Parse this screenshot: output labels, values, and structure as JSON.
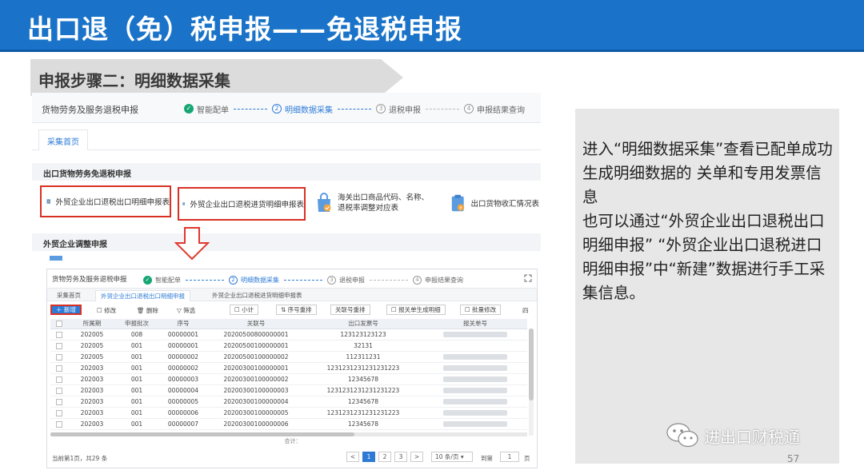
{
  "slide": {
    "title": "出口退（免）税申报——免退税申报",
    "step_banner": "申报步骤二：明细数据采集",
    "page_number": "57",
    "watermark": "进出口财税通"
  },
  "top_screen": {
    "breadcrumb_title": "货物劳务及服务退税申报",
    "steps": [
      {
        "num": "✓",
        "label": "智能配单"
      },
      {
        "num": "2",
        "label": "明细数据采集"
      },
      {
        "num": "3",
        "label": "退税申报"
      },
      {
        "num": "4",
        "label": "申报结果查询"
      }
    ],
    "home_tab": "采集首页",
    "section1": "出口货物劳务免退税申报",
    "section2": "外贸企业调整申报",
    "functions": [
      {
        "label": "外贸企业出口退税出口明细申报表"
      },
      {
        "label": "外贸企业出口退税进货明细申报表"
      },
      {
        "label": "海关出口商品代码、名称、退税率调整对应表"
      },
      {
        "label": "出口货物收汇情况表"
      }
    ]
  },
  "bottom_screen": {
    "breadcrumb_title": "货物劳务及服务退税申报",
    "steps": [
      {
        "num": "✓",
        "label": "智能配单"
      },
      {
        "num": "2",
        "label": "明细数据采集"
      },
      {
        "num": "3",
        "label": "退税申报"
      },
      {
        "num": "4",
        "label": "申报结果查询"
      }
    ],
    "tabs": [
      "采集首页",
      "外贸企业出口退税出口明细申报",
      "外贸企业出口退税进货明细申报表"
    ],
    "toolbar": {
      "new": "新增",
      "edit": "修改",
      "delete": "删除",
      "filter": "筛选",
      "subtotal": "小计",
      "renumber": "序号重排",
      "related_renumber": "关联号重排",
      "gen_form": "报关单生成明细",
      "batch_edit": "批量修改",
      "more": "四"
    },
    "columns": [
      "",
      "所属期",
      "申报批次",
      "序号",
      "关联号",
      "出口发票号",
      "报关单号"
    ],
    "rows": [
      [
        "202005",
        "008",
        "00000001",
        "20200500800000001",
        "123123123123"
      ],
      [
        "202005",
        "001",
        "00000001",
        "20200500100000001",
        "32131"
      ],
      [
        "202005",
        "001",
        "00000002",
        "20200500100000002",
        "112311231"
      ],
      [
        "202003",
        "001",
        "00000002",
        "20200300100000001",
        "1231231231231231223"
      ],
      [
        "202003",
        "001",
        "00000003",
        "20200300100000002",
        "12345678"
      ],
      [
        "202003",
        "001",
        "00000004",
        "20200300100000003",
        "1231231231231231223"
      ],
      [
        "202003",
        "001",
        "00000005",
        "20200300100000004",
        "12345678"
      ],
      [
        "202003",
        "001",
        "00000006",
        "20200300100000005",
        "1231231231231231223"
      ],
      [
        "202003",
        "001",
        "00000007",
        "20200300100000006",
        "12345678"
      ]
    ],
    "total_label": "合计：",
    "pager": {
      "info": "当前第1页，共29 条",
      "prev": "<",
      "pages": [
        "1",
        "2",
        "3"
      ],
      "next": ">",
      "page_size": "10 条/页",
      "goto_label": "到第",
      "goto_value": "1",
      "page_unit": "页"
    }
  },
  "explanation": "进入“明细数据采集”查看已配单成功生成明细数据的 关单和专用发票信息\n也可以通过“外贸企业出口退税出口明细申报” “外贸企业出口退税进口明细申报”中“新建”数据进行手工采集信息。",
  "colors": {
    "title_bar": "#1a73c8",
    "accent_blue": "#2e7bd6",
    "highlight_red": "#d93025",
    "done_green": "#17a673",
    "panel_gray": "#e7e7e7"
  }
}
